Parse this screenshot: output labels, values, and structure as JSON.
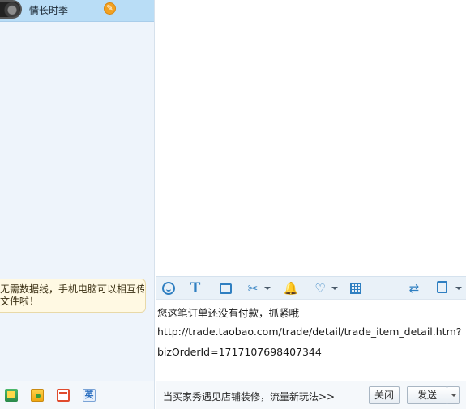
{
  "contact": {
    "name": "情长时季",
    "badge": "✎"
  },
  "tip": {
    "line1": "无需数据线，手机电脑可以相互传",
    "line2": "文件啦！"
  },
  "left_toolbar": {
    "icons": [
      "shop-icon",
      "wallet-icon",
      "store-icon",
      "translate-icon"
    ],
    "translate_glyph": "英"
  },
  "toolbar": {
    "icons": [
      "smile-icon",
      "font-icon",
      "screenshot-icon",
      "scissors-icon",
      "shake-icon",
      "heart-icon",
      "calculator-icon",
      "transfer-icon",
      "record-icon"
    ],
    "font_glyph": "T",
    "scissors_glyph": "✂",
    "shake_glyph": "🔔",
    "heart_glyph": "♡",
    "transfer_glyph": "⇄"
  },
  "message": {
    "line1": "您这笔订单还没有付款，抓紧哦",
    "line2": "http://trade.taobao.com/trade/detail/trade_item_detail.htm?",
    "line3": "bizOrderId=1717107698407344"
  },
  "bottom": {
    "promo": "当买家秀遇见店铺装修，流量新玩法>>",
    "close_label": "关闭",
    "send_label": "发送"
  }
}
